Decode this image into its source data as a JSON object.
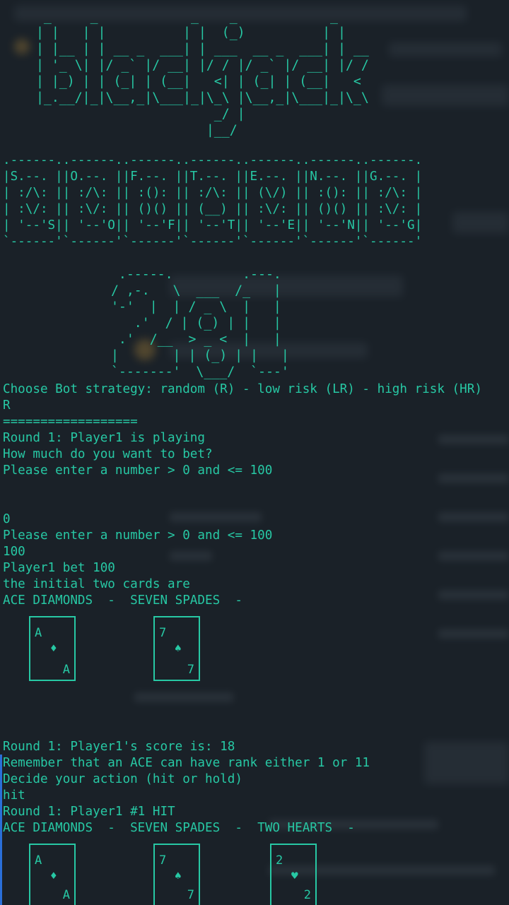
{
  "colors": {
    "text": "#27c8a4",
    "background": "#1a2128",
    "accent_bar": "#2a6fd8"
  },
  "banner": {
    "blackjack": "  _     _            _    _            _    \n | |   | |          | |  (_)          | |   \n | |__ | | __ _  ___| | ___  __ _  ___| | __\n | '_ \\| |/ _` |/ __| |/ / |/ _` |/ __| |/ /\n | |_) | | (_| | (__|   <| | (_| | (__|   < \n |_.__/|_|\\__,_|\\___|_|\\_\\ |\\__,_|\\___|_|\\_\\\n                        _/ |                \n                       |__/                 ",
    "cards": ".------..------..------..------..------..------..------.\n|S.--. ||O.--. ||F.--. ||T.--. ||E.--. ||N.--. ||G.--. |\n| :/\\: || :/\\: || :(): || :/\\: || (\\/) || :(): || :/\\: |\n| :\\/: || :\\/: || ()() || (__) || :\\/: || ()() || :\\/: |\n| '--'S|| '--'O|| '--'F|| '--'T|| '--'E|| '--'N|| '--'G|\n`------'`------'`------'`------'`------'`------'`------'",
    "twenty_one": "  .-----.         .---.\n / ,-.   \\  ___  /_   |\n '-'  |  | / _ \\  |   |\n    .'  / | (_) | |   |\n  .'  /__  > _ <  |   |\n |       | | (_) | |   |\n `-------'  \\___/  `---'"
  },
  "lines": {
    "strategy_prompt": "Choose Bot strategy: random (R) - low risk (LR) - high risk (HR)",
    "strategy_input": "R",
    "separator": "==================",
    "round_playing": "Round 1: Player1 is playing",
    "bet_question": "How much do you want to bet?",
    "bet_range_1": "Please enter a number > 0 and <= 100",
    "bet_input_1": "0",
    "bet_range_2": "Please enter a number > 0 and <= 100",
    "bet_input_2": "100",
    "bet_confirm": "Player1 bet 100",
    "initial_cards_label": "the initial two cards are",
    "initial_cards": "ACE DIAMONDS  -  SEVEN SPADES  -",
    "score": "Round 1: Player1's score is: 18",
    "ace_hint": "Remember that an ACE can have rank either 1 or 11",
    "action_prompt": "Decide your action (hit or hold)",
    "action_input": "hit",
    "hit_result": "Round 1: Player1 #1 HIT",
    "hit_cards": "ACE DIAMONDS  -  SEVEN SPADES  -  TWO HEARTS  -"
  },
  "hand1": [
    {
      "rank": "A",
      "suit": "♦"
    },
    {
      "rank": "7",
      "suit": "♠"
    }
  ],
  "hand2": [
    {
      "rank": "A",
      "suit": "♦"
    },
    {
      "rank": "7",
      "suit": "♠"
    },
    {
      "rank": "2",
      "suit": "♥"
    }
  ]
}
